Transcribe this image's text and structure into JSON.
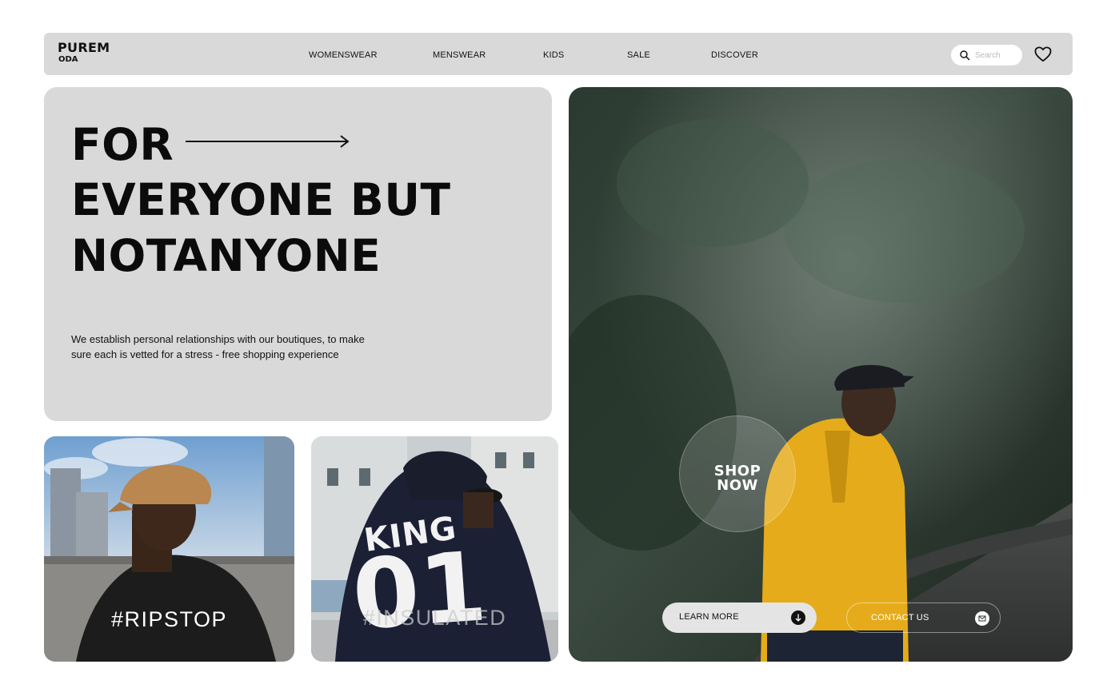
{
  "brand": {
    "line1": "PUREM",
    "line2": "ODA"
  },
  "nav": {
    "links": [
      "WOMENSWEAR",
      "MENSWEAR",
      "KIDS",
      "SALE",
      "DISCOVER"
    ],
    "search_placeholder": "Search"
  },
  "hero": {
    "headline": [
      "FOR",
      "EVERYONE BUT",
      "NOTANYONE"
    ],
    "subtext": "We establish personal relationships with our boutiques, to make sure each is vetted for a stress - free shopping experience"
  },
  "tiles": {
    "ripstop": "#RIPSTOP",
    "insulated": "#INSULATED",
    "jacket_print_1": "KING",
    "jacket_print_2": "01"
  },
  "feature": {
    "shop_now": [
      "SHOP",
      "NOW"
    ],
    "learn_more": "LEARN MORE",
    "contact_us": "CONTACT US"
  },
  "colors": {
    "panel": "#d9d9d9",
    "text": "#0b0b0b",
    "hoodie": "#e5ab1a",
    "forest": "#1e2b22"
  },
  "icons": [
    "search-icon",
    "heart-icon",
    "arrow-right-icon",
    "arrow-down-icon",
    "mail-icon"
  ]
}
